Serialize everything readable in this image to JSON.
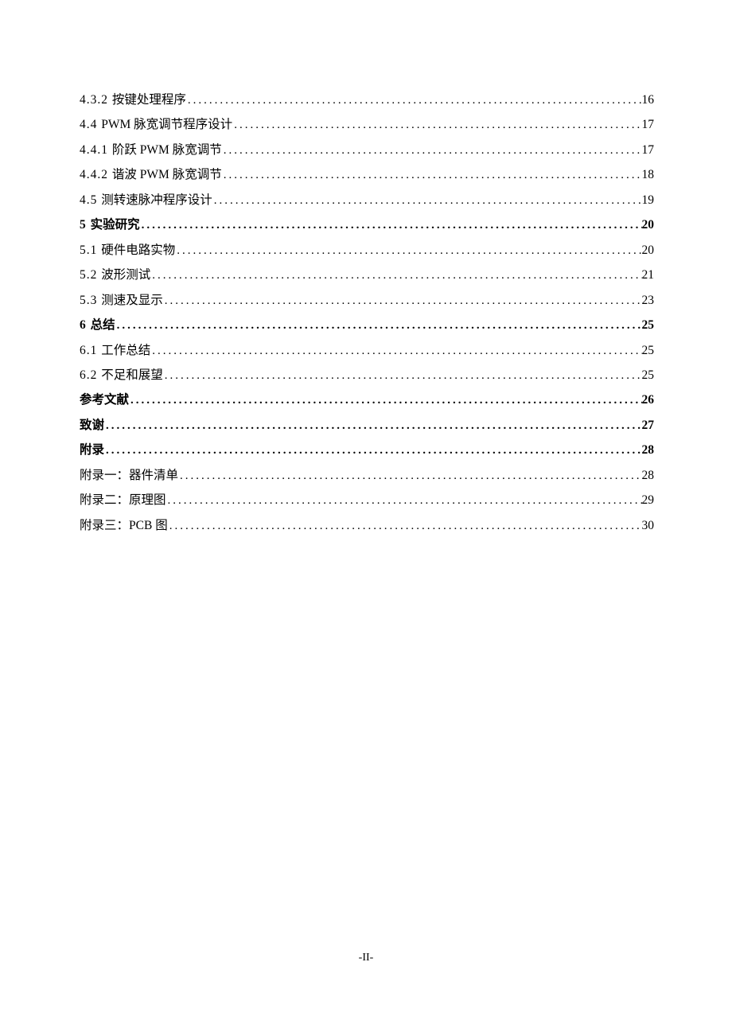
{
  "footer": "-II-",
  "toc": [
    {
      "num": "4.3.2",
      "title": "按键处理程序",
      "page": "16",
      "bold": false,
      "latin": ""
    },
    {
      "num": "4.4",
      "title": "脉宽调节程序设计",
      "page": "17",
      "bold": false,
      "latin": "PWM "
    },
    {
      "num": "4.4.1",
      "title": "阶跃",
      "title2": "脉宽调节",
      "page": "17",
      "bold": false,
      "latin": " PWM "
    },
    {
      "num": "4.4.2",
      "title": "谐波",
      "title2": "脉宽调节",
      "page": "18",
      "bold": false,
      "latin": " PWM "
    },
    {
      "num": "4.5",
      "title": "测转速脉冲程序设计",
      "page": "19",
      "bold": false,
      "latin": ""
    },
    {
      "num": "5",
      "title": "实验研究",
      "page": "20",
      "bold": true,
      "latin": ""
    },
    {
      "num": "5.1",
      "title": "硬件电路实物",
      "page": "20",
      "bold": false,
      "latin": ""
    },
    {
      "num": "5.2",
      "title": "波形测试",
      "page": "21",
      "bold": false,
      "latin": ""
    },
    {
      "num": "5.3",
      "title": "测速及显示",
      "page": "23",
      "bold": false,
      "latin": ""
    },
    {
      "num": "6",
      "title": "总结",
      "page": "25",
      "bold": true,
      "latin": ""
    },
    {
      "num": "6.1",
      "title": "工作总结",
      "page": "25",
      "bold": false,
      "latin": ""
    },
    {
      "num": "6.2",
      "title": "不足和展望",
      "page": "25",
      "bold": false,
      "latin": ""
    },
    {
      "num": "",
      "title": "参考文献",
      "page": "26",
      "bold": true,
      "latin": ""
    },
    {
      "num": "",
      "title": "致谢",
      "page": "27",
      "bold": true,
      "latin": ""
    },
    {
      "num": "",
      "title": "附录",
      "page": "28",
      "bold": true,
      "latin": ""
    },
    {
      "num": "",
      "title": "附录一：器件清单",
      "page": "28",
      "bold": false,
      "latin": ""
    },
    {
      "num": "",
      "title": "附录二：原理图",
      "page": "29",
      "bold": false,
      "latin": ""
    },
    {
      "num": "",
      "title": "附录三：",
      "title2": "图",
      "page": "30",
      "bold": false,
      "latin": "PCB "
    }
  ]
}
